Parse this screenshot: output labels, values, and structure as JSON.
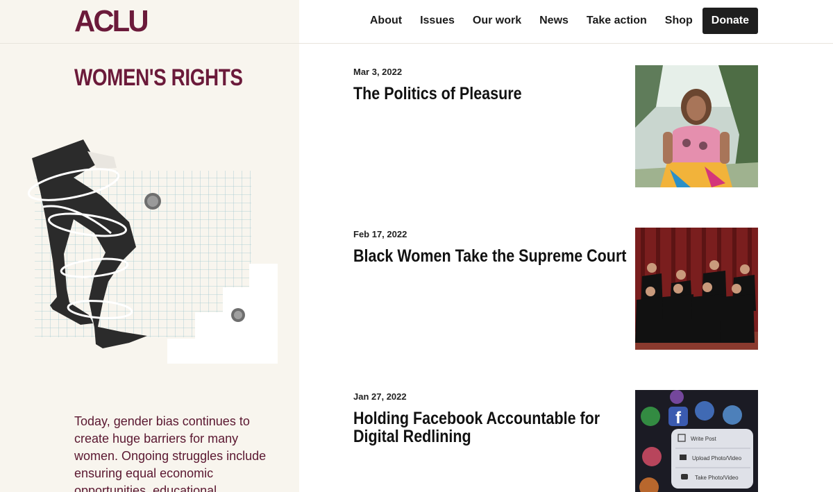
{
  "logo": "ACLU",
  "nav": {
    "items": [
      "About",
      "Issues",
      "Our work",
      "News",
      "Take action",
      "Shop"
    ],
    "donate_label": "Donate"
  },
  "page": {
    "title": "WOMEN'S RIGHTS",
    "intro": "Today, gender bias continues to create huge barriers for many women. Ongoing struggles include ensuring equal economic opportunities, educational"
  },
  "articles": [
    {
      "date": "Mar 3, 2022",
      "title": "The Politics of Pleasure"
    },
    {
      "date": "Feb 17, 2022",
      "title": "Black Women Take the Supreme Court"
    },
    {
      "date": "Jan 27, 2022",
      "title": "Holding Facebook Accountable for Digital Redlining"
    }
  ],
  "phone_menu": {
    "items": [
      "Write Post",
      "Upload Photo/Video",
      "Take Photo/Video"
    ]
  },
  "colors": {
    "brand": "#6b1a3a",
    "panel": "#f8f5ee",
    "donate_bg": "#1e1e1e"
  }
}
